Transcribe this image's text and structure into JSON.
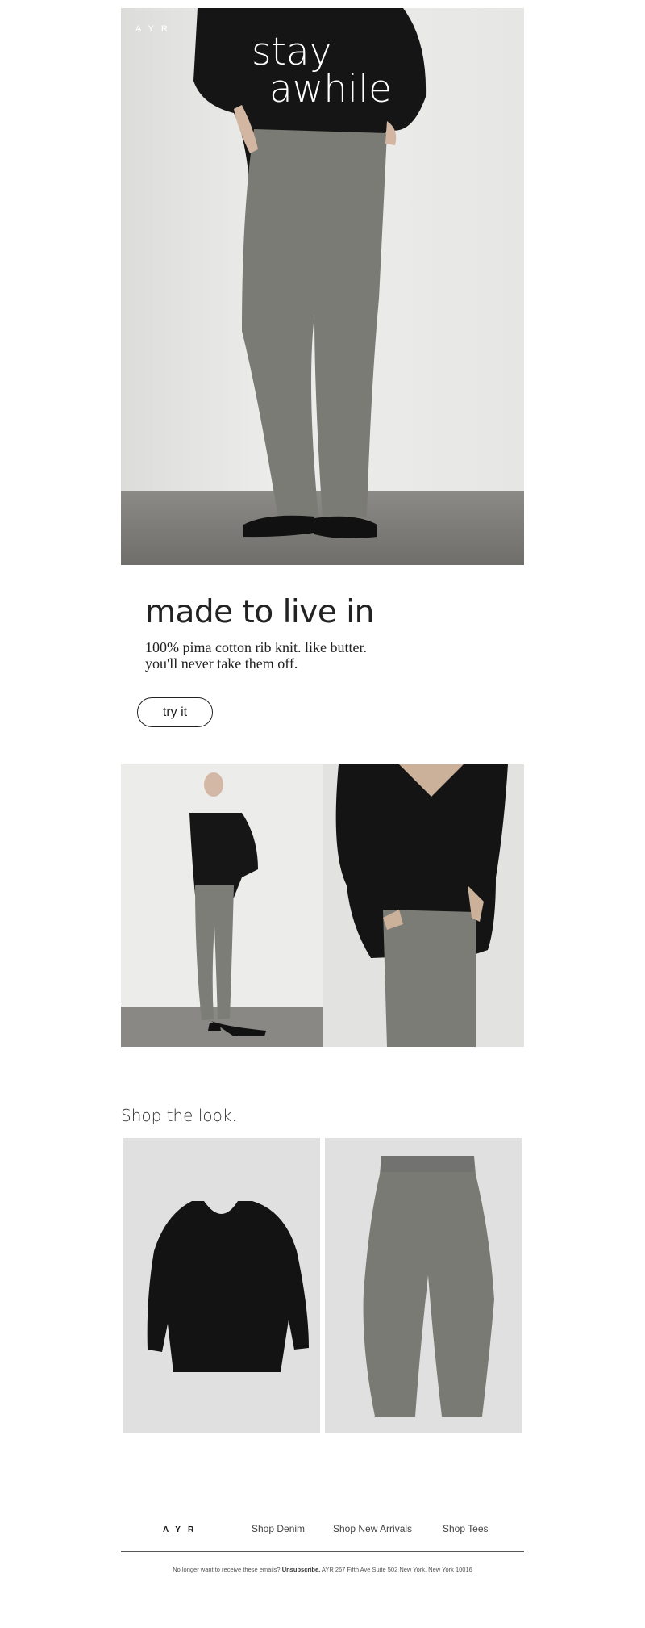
{
  "hero": {
    "logo": "AYR",
    "headline_line1": "stay",
    "headline_line2": "awhile"
  },
  "copy": {
    "title": "made to live in",
    "subtitle_line1": "100% pima cotton rib knit. like butter.",
    "subtitle_line2": "you'll never take them off.",
    "button_label": "try it"
  },
  "shop": {
    "title": "Shop the look.",
    "products": [
      {
        "name": "black v-neck sweater"
      },
      {
        "name": "grey rib knit pants"
      }
    ]
  },
  "footer": {
    "logo": "AYR",
    "nav": [
      "Shop Denim",
      "Shop New Arrivals",
      "Shop Tees"
    ],
    "legal_prefix": "No longer want to receive these emails?",
    "unsubscribe_label": "Unsubscribe.",
    "address": "AYR 267 Fifth Ave Suite 502 New York, New York 10016"
  },
  "colors": {
    "text": "#222222",
    "wall": "#e9e9e7",
    "floor": "#7b7a76",
    "sweater": "#141414",
    "pants": "#7a7a74"
  }
}
